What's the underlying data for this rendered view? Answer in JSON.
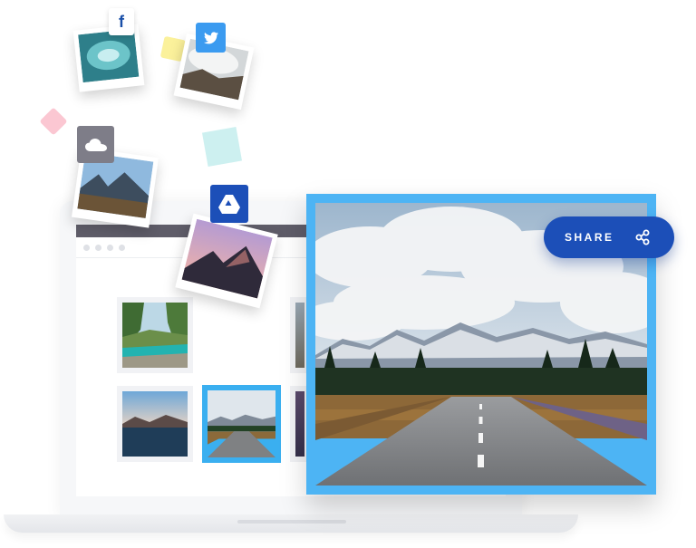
{
  "share_button": {
    "label": "SHARE",
    "icon": "share-icon"
  },
  "cloud_sources": [
    {
      "name": "facebook",
      "icon": "facebook-icon",
      "glyph": "f",
      "color": "#1a4fa8"
    },
    {
      "name": "twitter",
      "icon": "twitter-icon",
      "color": "#3b9bf0"
    },
    {
      "name": "cloud",
      "icon": "cloud-icon",
      "color": "#7e7d88"
    },
    {
      "name": "google-drive",
      "icon": "google-drive-icon",
      "color": "#1c4fb8"
    }
  ],
  "colors": {
    "accent": "#4db4f4",
    "share": "#1c4fb8",
    "confetti_yellow": "#fbf19b",
    "confetti_pink": "#fbc7d2",
    "confetti_teal": "#cdf0f0"
  },
  "gallery": {
    "thumbnails": [
      {
        "subject": "river-canyon",
        "selected": false
      },
      {
        "subject": "lake-sunset",
        "selected": false
      },
      {
        "subject": "road-mountains",
        "selected": true
      }
    ]
  },
  "main_photo": {
    "subject": "road-to-mountains"
  }
}
